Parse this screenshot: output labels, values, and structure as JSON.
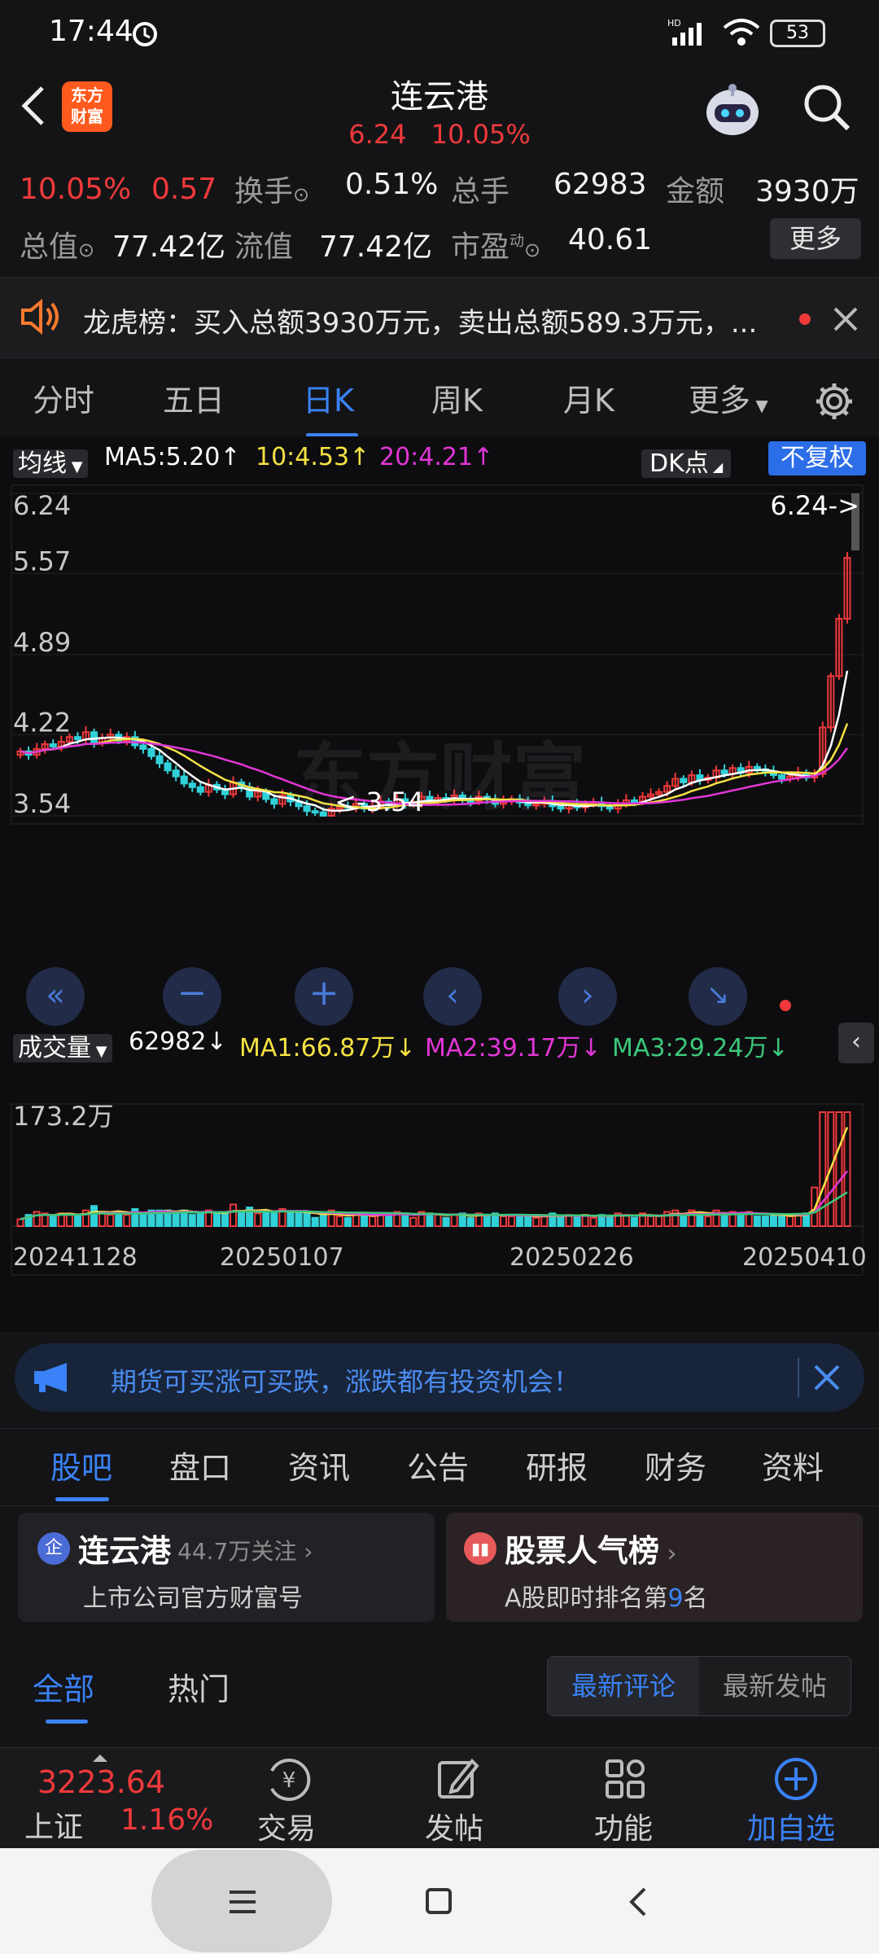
{
  "status_bar": {
    "time": "17:44",
    "battery": "53"
  },
  "header": {
    "logo_text_1": "东方",
    "logo_text_2": "财富",
    "title": "连云港",
    "price": "6.24",
    "change_pct": "10.05%"
  },
  "quote": {
    "pct": "10.05%",
    "chg": "0.57",
    "turnover_label": "换手",
    "turnover": "0.51%",
    "vol_label": "总手",
    "vol": "62983",
    "amount_label": "金额",
    "amount": "3930万",
    "mktcap_label": "总值",
    "mktcap": "77.42亿",
    "float_label": "流值",
    "float": "77.42亿",
    "pe_label": "市盈",
    "pe_sup": "动",
    "pe": "40.61",
    "more": "更多"
  },
  "notice": {
    "text": "龙虎榜：买入总额3930万元，卖出总额589.3万元，..."
  },
  "ktabs": [
    "分时",
    "五日",
    "日K",
    "周K",
    "月K",
    "更多"
  ],
  "chart_header": {
    "ma_select": "均线",
    "ma5": "MA5:5.20",
    "ma10": "10:4.53",
    "ma20": "20:4.21",
    "dk": "DK点",
    "fq": "不复权"
  },
  "vol_header": {
    "select": "成交量",
    "vol": "62982",
    "ma1": "MA1:66.87万",
    "ma2": "MA2:39.17万",
    "ma3": "MA3:29.24万"
  },
  "chart_data": {
    "type": "candlestick",
    "price_axis_labels": [
      "6.24",
      "5.57",
      "4.89",
      "4.22",
      "3.54"
    ],
    "ylim": [
      3.54,
      6.24
    ],
    "last_price_label": "6.24->",
    "low_label": "<-3.54",
    "vol_axis_label": "173.2万",
    "x_tick_labels": [
      "20241128",
      "20250107",
      "20250226",
      "20250410"
    ],
    "watermark": "东方财富",
    "close_path": [
      4.08,
      4.05,
      4.1,
      4.14,
      4.12,
      4.16,
      4.2,
      4.18,
      4.24,
      4.15,
      4.19,
      4.22,
      4.17,
      4.2,
      4.13,
      4.1,
      4.04,
      3.98,
      3.92,
      3.87,
      3.81,
      3.78,
      3.74,
      3.8,
      3.76,
      3.72,
      3.82,
      3.78,
      3.7,
      3.74,
      3.68,
      3.64,
      3.71,
      3.66,
      3.62,
      3.58,
      3.57,
      3.54,
      3.6,
      3.62,
      3.61,
      3.64,
      3.6,
      3.62,
      3.66,
      3.63,
      3.68,
      3.64,
      3.65,
      3.7,
      3.66,
      3.69,
      3.68,
      3.71,
      3.67,
      3.66,
      3.7,
      3.68,
      3.64,
      3.66,
      3.68,
      3.65,
      3.63,
      3.64,
      3.66,
      3.62,
      3.6,
      3.63,
      3.61,
      3.64,
      3.65,
      3.62,
      3.6,
      3.64,
      3.67,
      3.66,
      3.7,
      3.72,
      3.74,
      3.79,
      3.85,
      3.82,
      3.88,
      3.84,
      3.86,
      3.92,
      3.89,
      3.94,
      3.9,
      3.95,
      3.93,
      3.91,
      3.88,
      3.85,
      3.87,
      3.9,
      3.86,
      3.89,
      4.28,
      4.71,
      5.19,
      5.7
    ],
    "ma5_last": 5.2,
    "ma10_last": 4.53,
    "ma20_last": 4.21
  },
  "banner": {
    "text": "期货可买涨可买跌，涨跌都有投资机会！"
  },
  "bottom_tabs": [
    "股吧",
    "盘口",
    "资讯",
    "公告",
    "研报",
    "财务",
    "资料"
  ],
  "card_left": {
    "name": "连云港",
    "follow": "44.7万关注",
    "desc": "上市公司官方财富号"
  },
  "card_right": {
    "name": "股票人气榜",
    "desc_prefix": "A股即时排名第",
    "rank": "9",
    "desc_suffix": "名"
  },
  "filters": {
    "all": "全部",
    "hot": "热门",
    "latest_comment": "最新评论",
    "latest_post": "最新发帖"
  },
  "dock": {
    "index_value": "3223.64",
    "index_name": "上证",
    "index_pct": "1.16%",
    "trade": "交易",
    "post": "发帖",
    "func": "功能",
    "add": "加自选"
  }
}
